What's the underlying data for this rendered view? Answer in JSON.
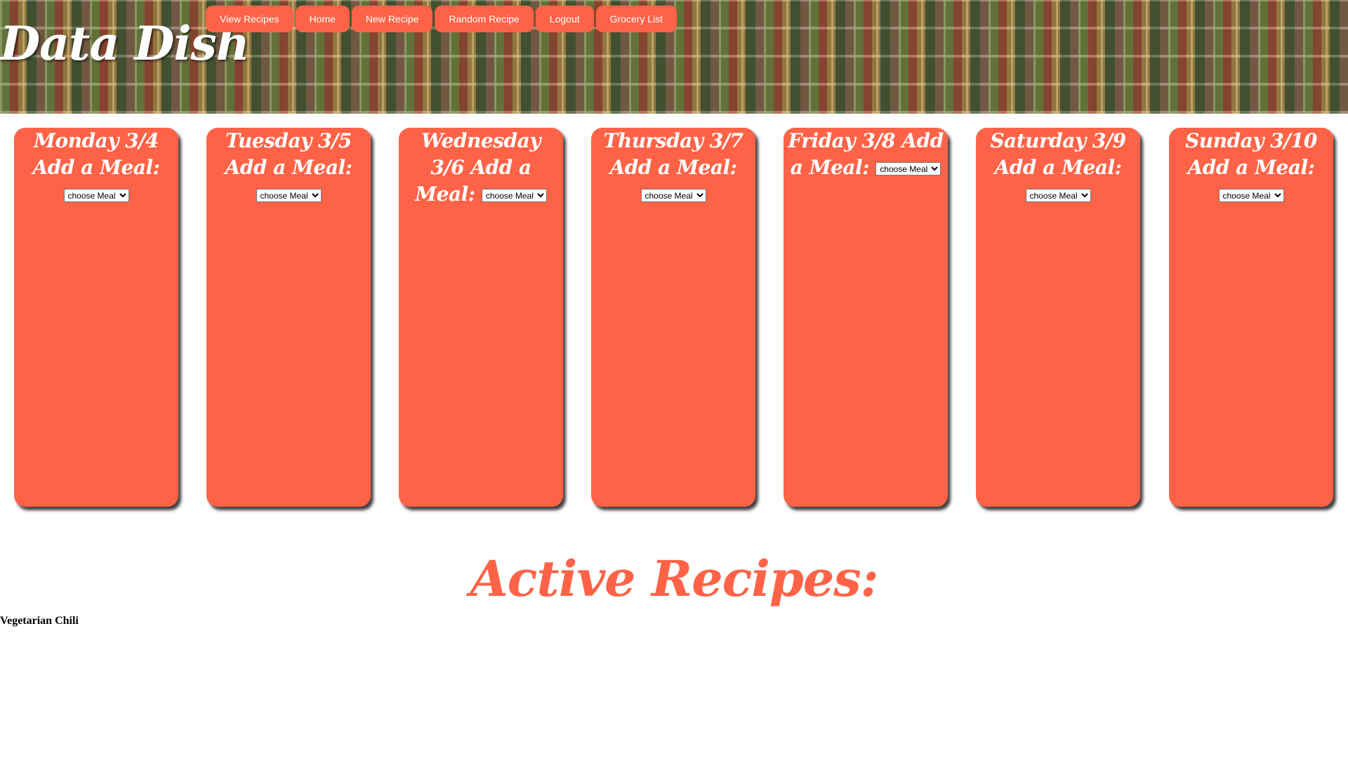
{
  "header": {
    "logo": "Data Dish"
  },
  "nav": [
    {
      "label": "View Recipes"
    },
    {
      "label": "Home"
    },
    {
      "label": "New Recipe"
    },
    {
      "label": "Random Recipe"
    },
    {
      "label": "Logout"
    },
    {
      "label": "Grocery List"
    }
  ],
  "days": [
    {
      "heading": "Monday 3/4 Add a Meal:",
      "select_value": "choose Meal"
    },
    {
      "heading": "Tuesday 3/5 Add a Meal:",
      "select_value": "choose Meal"
    },
    {
      "heading": "Wednesday 3/6 Add a Meal:",
      "select_value": "choose Meal"
    },
    {
      "heading": "Thursday 3/7 Add a Meal:",
      "select_value": "choose Meal"
    },
    {
      "heading": "Friday 3/8 Add a Meal:",
      "select_value": "choose Meal"
    },
    {
      "heading": "Saturday 3/9 Add a Meal:",
      "select_value": "choose Meal"
    },
    {
      "heading": "Sunday 3/10 Add a Meal:",
      "select_value": "choose Meal"
    }
  ],
  "active": {
    "title": "Active Recipes:",
    "recipes": [
      "Vegetarian Chili"
    ]
  },
  "colors": {
    "accent": "#ff6347",
    "text_on_accent": "#ffffff"
  }
}
